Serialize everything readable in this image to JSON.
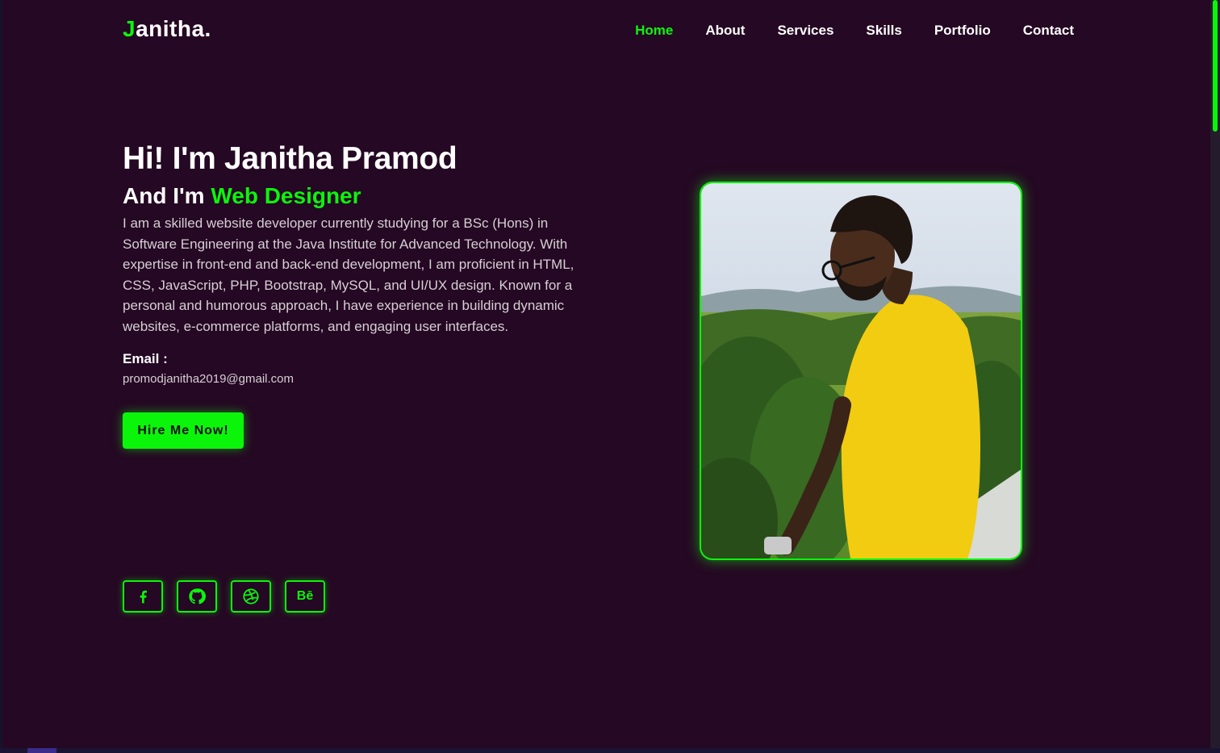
{
  "logo": {
    "first_letter": "J",
    "rest": "anitha."
  },
  "nav": {
    "items": [
      {
        "label": "Home",
        "active": true
      },
      {
        "label": "About"
      },
      {
        "label": "Services"
      },
      {
        "label": "Skills"
      },
      {
        "label": "Portfolio"
      },
      {
        "label": "Contact"
      }
    ]
  },
  "hero": {
    "title": "Hi! I'm Janitha Pramod",
    "subtitle_prefix": "And I'm",
    "subtitle_role": "Web Designer",
    "description": "I am a skilled website developer currently studying for a BSc (Hons) in Software Engineering at the Java Institute for Advanced Technology. With expertise in front-end and back-end development, I am proficient in HTML, CSS, JavaScript, PHP, Bootstrap, MySQL, and UI/UX design. Known for a personal and humorous approach, I have experience in building dynamic websites, e-commerce platforms, and engaging user interfaces.",
    "email_label": "Email :",
    "email": "promodjanitha2019@gmail.com",
    "cta_label": "Hire Me Now!"
  },
  "socials": [
    {
      "icon": "facebook-icon"
    },
    {
      "icon": "github-icon"
    },
    {
      "icon": "dribbble-icon"
    },
    {
      "icon": "behance-icon",
      "text": "Bē"
    }
  ],
  "colors": {
    "background": "#250823",
    "accent": "#0bf50b",
    "text": "#ffffff",
    "muted": "#d6cfd5"
  }
}
